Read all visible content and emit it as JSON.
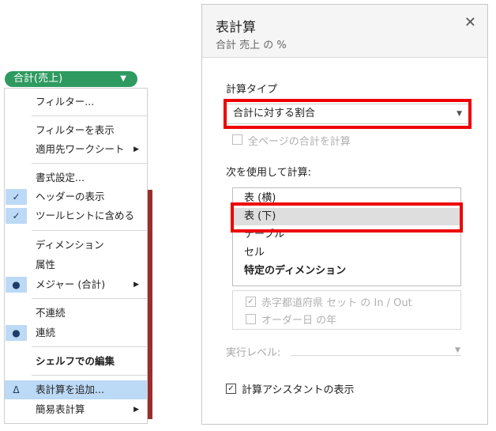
{
  "pill": {
    "label": "合計(売上)",
    "caret": "▼"
  },
  "menu": {
    "items": [
      {
        "label": "フィルター..."
      },
      {
        "label": "フィルターを表示"
      },
      {
        "label": "適用先ワークシート",
        "arrow": "▶"
      },
      {
        "label": "書式設定..."
      },
      {
        "label": "ヘッダーの表示",
        "mark": "✓"
      },
      {
        "label": "ツールヒントに含める",
        "mark": "✓"
      },
      {
        "label": "ディメンション"
      },
      {
        "label": "属性"
      },
      {
        "label": "メジャー (合計)",
        "mark": "●",
        "arrow": "▶"
      },
      {
        "label": "不連続"
      },
      {
        "label": "連続",
        "mark": "●"
      },
      {
        "label": "シェルフでの編集"
      },
      {
        "label": "表計算を追加...",
        "mark": "Δ"
      },
      {
        "label": "簡易表計算",
        "arrow": "▶"
      }
    ]
  },
  "dialog": {
    "title": "表計算",
    "subtitle": "合計 売上 の %",
    "close": "✕",
    "calc_type_label": "計算タイプ",
    "calc_type_value": "合計に対する割合",
    "calc_type_caret": "▼",
    "all_pages_label": "全ページの合計を計算",
    "compute_using_label": "次を使用して計算:",
    "compute_options": [
      "表 (横)",
      "表 (下)",
      "テーブル",
      "セル",
      "特定のディメンション"
    ],
    "selected_option": "表 (下)",
    "dimensions": [
      {
        "label": "赤字都道府県 セット の In / Out",
        "checked": true,
        "check_mark": "✓"
      },
      {
        "label": "オーダー日 の年",
        "checked": false
      }
    ],
    "exec_level_label": "実行レベル:",
    "exec_level_caret": "▼",
    "assistant_label": "計算アシスタントの表示",
    "assistant_check": "✓"
  },
  "colors": {
    "pill": "#2e9a60",
    "highlight": "#bcd9f5",
    "annotation_red": "#ee0000",
    "selected_row": "#dedede"
  }
}
